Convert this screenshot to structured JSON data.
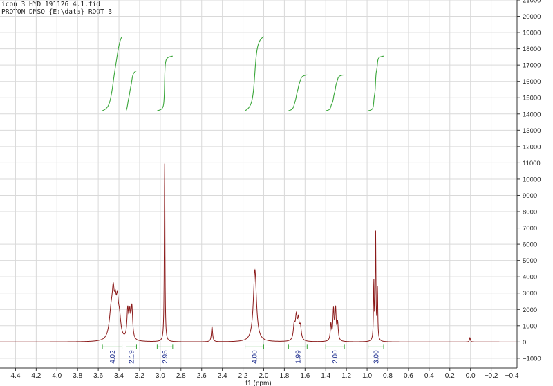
{
  "header": {
    "line1": "icon_3_HYD_191126_4.1.fid",
    "line2": "PROTON DMSO {E:\\data} ROOT 3"
  },
  "colors": {
    "spectrum": "#8b1a1a",
    "integral": "#3aa63a",
    "integral_label": "#1a2a8c",
    "grid": "#d9d9d9",
    "axis": "#333333"
  },
  "chart_data": {
    "type": "line",
    "title": "",
    "xlabel": "f1 (ppm)",
    "ylabel": "",
    "xlim": [
      4.55,
      -0.45
    ],
    "ylim": [
      -1600,
      21000
    ],
    "x_reversed": true,
    "grid": true,
    "x_ticks": [
      4.4,
      4.2,
      4.0,
      3.8,
      3.6,
      3.4,
      3.2,
      3.0,
      2.8,
      2.6,
      2.4,
      2.2,
      2.0,
      1.8,
      1.6,
      1.4,
      1.2,
      1.0,
      0.8,
      0.6,
      0.4,
      0.2,
      0.0,
      -0.2,
      -0.4
    ],
    "x_tick_labels": [
      "4.4",
      "4.2",
      "4.0",
      "3.8",
      "3.6",
      "3.4",
      "3.2",
      "3.0",
      "2.8",
      "2.6",
      "2.4",
      "2.2",
      "2.0",
      "1.8",
      "1.6",
      "1.4",
      "1.2",
      "1.0",
      "0.8",
      "0.6",
      "0.4",
      "0.2",
      "0.0",
      "−0.2",
      "−0.4"
    ],
    "y_ticks": [
      -1000,
      0,
      1000,
      2000,
      3000,
      4000,
      5000,
      6000,
      7000,
      8000,
      9000,
      10000,
      11000,
      12000,
      13000,
      14000,
      15000,
      16000,
      17000,
      18000,
      19000,
      20000,
      21000
    ],
    "y_tick_labels": [
      "−1000",
      "0",
      "1000",
      "2000",
      "3000",
      "4000",
      "5000",
      "6000",
      "7000",
      "8000",
      "9000",
      "10000",
      "11000",
      "12000",
      "13000",
      "14000",
      "15000",
      "16000",
      "17000",
      "18000",
      "19000",
      "20000",
      "21000"
    ],
    "peaks": [
      {
        "x": 3.475,
        "y": 1700,
        "w": 0.022
      },
      {
        "x": 3.455,
        "y": 2050,
        "w": 0.012
      },
      {
        "x": 3.435,
        "y": 1600,
        "w": 0.012
      },
      {
        "x": 3.415,
        "y": 1850,
        "w": 0.012
      },
      {
        "x": 3.395,
        "y": 1200,
        "w": 0.016
      },
      {
        "x": 3.315,
        "y": 1750,
        "w": 0.009
      },
      {
        "x": 3.295,
        "y": 1450,
        "w": 0.009
      },
      {
        "x": 3.275,
        "y": 1950,
        "w": 0.009
      },
      {
        "x": 2.958,
        "y": 11000,
        "w": 0.004
      },
      {
        "x": 2.5,
        "y": 950,
        "w": 0.007
      },
      {
        "x": 2.085,
        "y": 4420,
        "w": 0.018
      },
      {
        "x": 1.705,
        "y": 900,
        "w": 0.01
      },
      {
        "x": 1.685,
        "y": 1350,
        "w": 0.01
      },
      {
        "x": 1.665,
        "y": 1150,
        "w": 0.01
      },
      {
        "x": 1.645,
        "y": 800,
        "w": 0.01
      },
      {
        "x": 1.35,
        "y": 1000,
        "w": 0.007
      },
      {
        "x": 1.325,
        "y": 1850,
        "w": 0.007
      },
      {
        "x": 1.305,
        "y": 1900,
        "w": 0.007
      },
      {
        "x": 1.285,
        "y": 1050,
        "w": 0.007
      },
      {
        "x": 0.935,
        "y": 3500,
        "w": 0.004
      },
      {
        "x": 0.918,
        "y": 6700,
        "w": 0.004
      },
      {
        "x": 0.9,
        "y": 3050,
        "w": 0.004
      },
      {
        "x": 0.005,
        "y": 270,
        "w": 0.005
      }
    ],
    "integrals": [
      {
        "from": 3.56,
        "to": 3.37,
        "value": "4.02",
        "curve_start": 14200,
        "curve_end": 18750
      },
      {
        "from": 3.33,
        "to": 3.23,
        "value": "2.19",
        "curve_start": 14200,
        "curve_end": 16650
      },
      {
        "from": 3.03,
        "to": 2.88,
        "value": "2.95",
        "curve_start": 14200,
        "curve_end": 17550
      },
      {
        "from": 2.18,
        "to": 2.0,
        "value": "4.00",
        "curve_start": 14200,
        "curve_end": 18750
      },
      {
        "from": 1.76,
        "to": 1.58,
        "value": "1.99",
        "curve_start": 14200,
        "curve_end": 16400
      },
      {
        "from": 1.4,
        "to": 1.22,
        "value": "2.00",
        "curve_start": 14200,
        "curve_end": 16400
      },
      {
        "from": 0.99,
        "to": 0.84,
        "value": "3.00",
        "curve_start": 14200,
        "curve_end": 17550
      }
    ]
  }
}
